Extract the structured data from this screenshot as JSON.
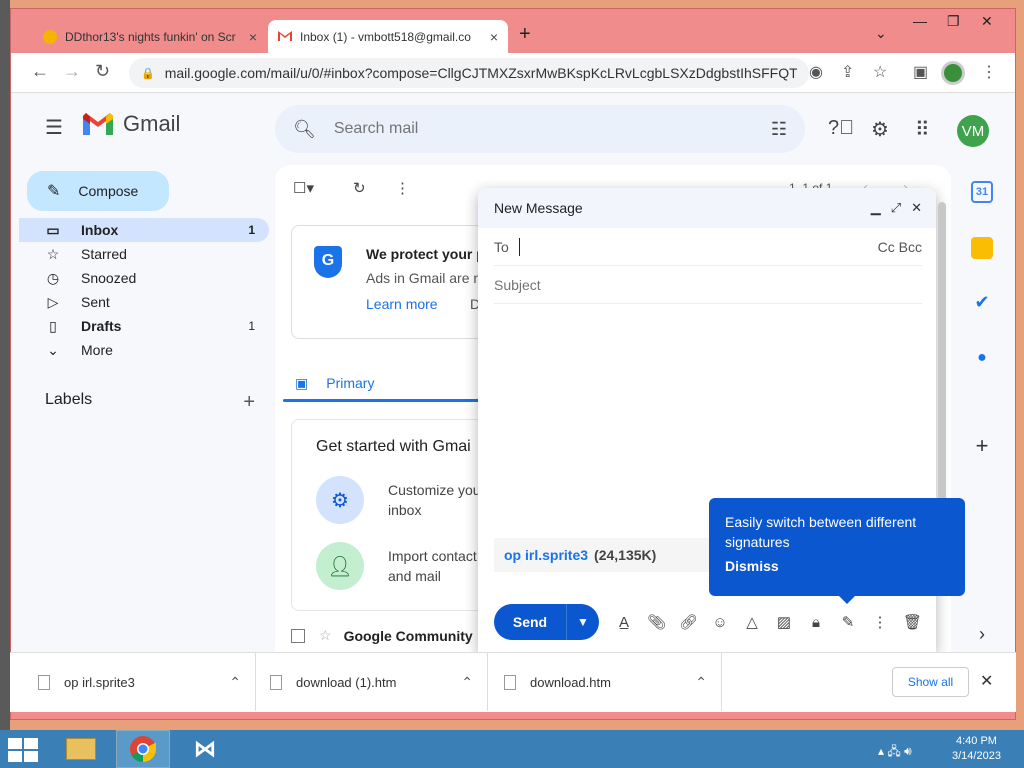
{
  "browser": {
    "tabs": [
      {
        "title": "DDthor13's nights funkin' on Scr",
        "close": "×"
      },
      {
        "title": "Inbox (1) - vmbott518@gmail.co",
        "close": "×"
      }
    ],
    "new_tab": "+",
    "url": "mail.google.com/mail/u/0/#inbox?compose=CllgCJTMXZsxrMwBKspKcLRvLcgbLSXzDdgbstIhSFFQTL..."
  },
  "gmail": {
    "logo_text": "Gmail",
    "search_placeholder": "Search mail",
    "avatar_initials": "VM",
    "compose_label": "Compose",
    "nav": [
      {
        "label": "Inbox",
        "count": "1"
      },
      {
        "label": "Starred",
        "count": ""
      },
      {
        "label": "Snoozed",
        "count": ""
      },
      {
        "label": "Sent",
        "count": ""
      },
      {
        "label": "Drafts",
        "count": "1"
      },
      {
        "label": "More",
        "count": ""
      }
    ],
    "labels_heading": "Labels",
    "pager": "1–1 of 1",
    "protect_card": {
      "title": "We protect your p",
      "subtitle": "Ads in Gmail are n",
      "learn_more": "Learn more",
      "dismiss_partial": "D"
    },
    "primary_tab": "Primary",
    "get_started": {
      "title": "Get started with Gmai",
      "items": [
        "Customize you inbox",
        "Import contact and mail"
      ]
    },
    "mail_row_sender": "Google Community"
  },
  "compose_window": {
    "title": "New Message",
    "to_label": "To",
    "cc_bcc": "Cc Bcc",
    "subject_placeholder": "Subject",
    "attachment_name": "op irl.sprite3",
    "attachment_size": "(24,135K)",
    "send_label": "Send"
  },
  "tooltip": {
    "text": "Easily switch between different signatures",
    "dismiss": "Dismiss"
  },
  "downloads": {
    "items": [
      "op irl.sprite3",
      "download (1).htm",
      "download.htm"
    ],
    "show_all": "Show all"
  },
  "taskbar": {
    "time": "4:40 PM",
    "date": "3/14/2023"
  },
  "colors": {
    "accent": "#0b57d0",
    "compose_bg": "#c2e7ff",
    "window_frame": "#f08c8c",
    "avatar_bg": "#3fa34d"
  }
}
